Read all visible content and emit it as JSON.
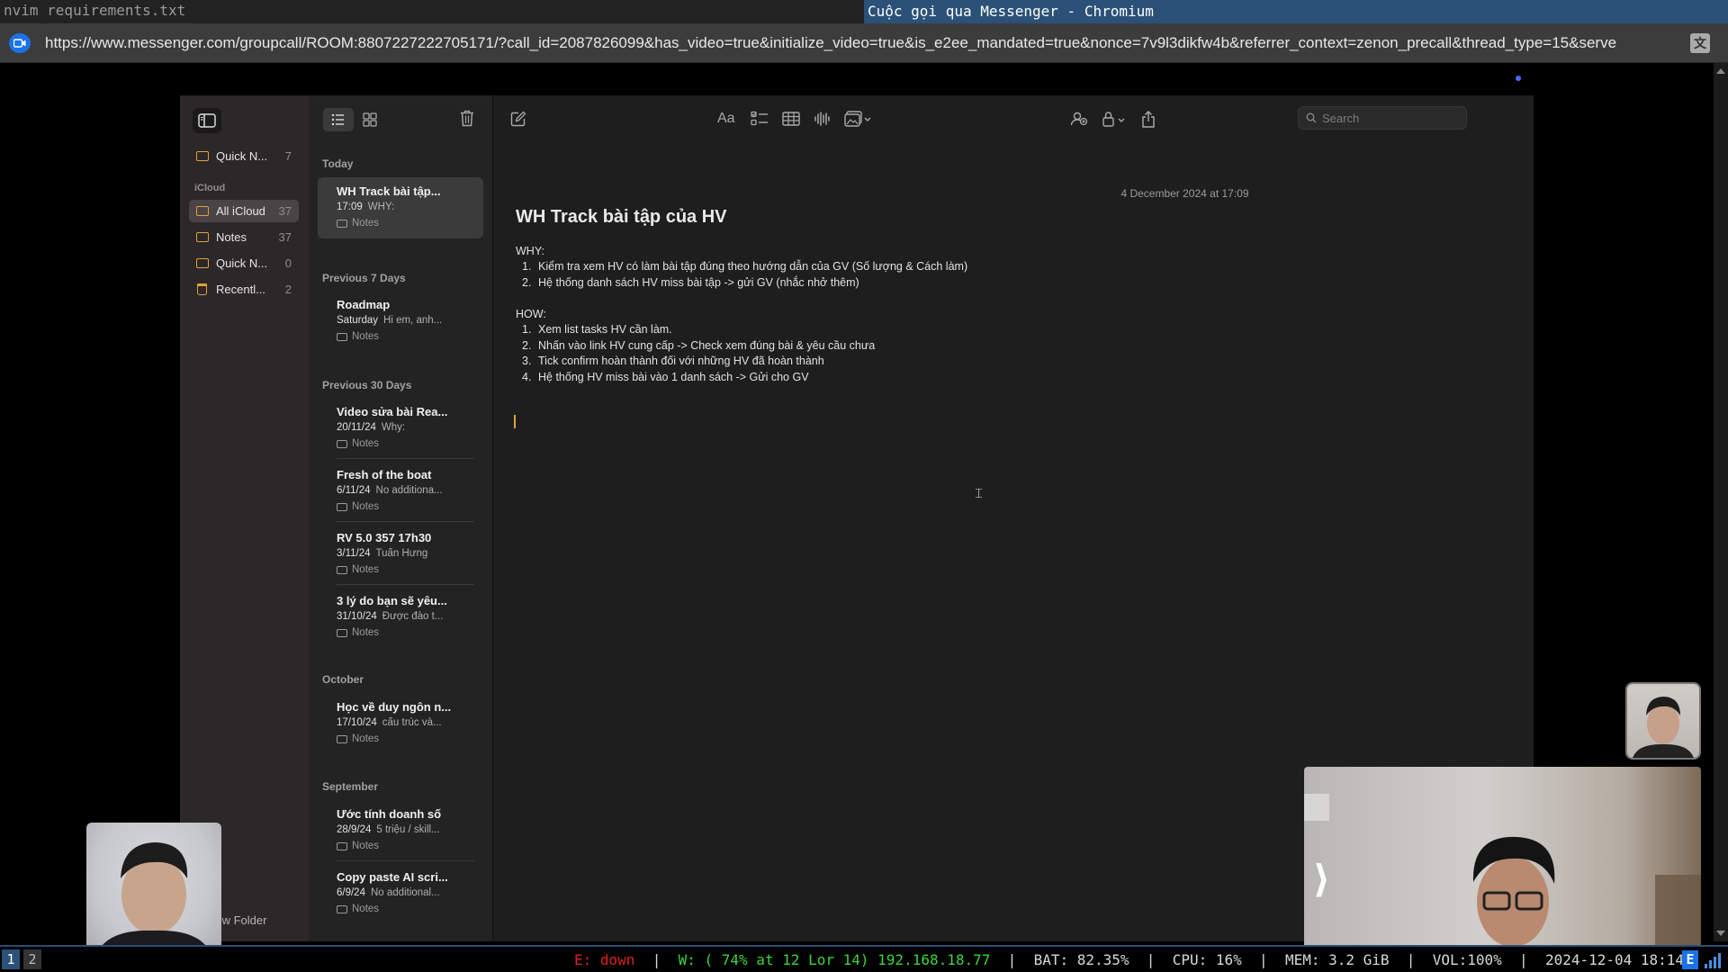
{
  "wm": {
    "left_title": "nvim requirements.txt",
    "right_title": "Cuộc gọi qua Messenger - Chromium"
  },
  "browser": {
    "url": "https://www.messenger.com/groupcall/ROOM:8807227222705171/?call_id=2087826099&has_video=true&initialize_video=true&is_e2ee_mandated=true&nonce=7v9l3dikfw4b&referrer_context=zenon_precall&thread_type=15&serve",
    "translate_icon": "translate-icon",
    "camera_icon": "video-camera-icon"
  },
  "folders": {
    "items": [
      {
        "name": "Quick N...",
        "count": "7"
      },
      {
        "name": "All iCloud",
        "count": "37"
      },
      {
        "name": "Notes",
        "count": "37"
      },
      {
        "name": "Quick N...",
        "count": "0"
      },
      {
        "name": "Recentl...",
        "count": "2"
      }
    ],
    "icloud_label": "iCloud",
    "new_folder": "New Folder"
  },
  "notelist": {
    "groups": [
      "Today",
      "Previous 7 Days",
      "Previous 30 Days",
      "October",
      "September"
    ],
    "notes": [
      {
        "title": "WH Track bài tập...",
        "date": "17:09",
        "preview": "WHY:",
        "folder": "Notes"
      },
      {
        "title": "Roadmap",
        "date": "Saturday",
        "preview": "Hi em, anh...",
        "folder": "Notes"
      },
      {
        "title": "Video sửa bài Rea...",
        "date": "20/11/24",
        "preview": "Why:",
        "folder": "Notes"
      },
      {
        "title": "Fresh of the boat",
        "date": "6/11/24",
        "preview": "No additiona...",
        "folder": "Notes"
      },
      {
        "title": "RV 5.0 357 17h30",
        "date": "3/11/24",
        "preview": "Tuấn Hưng",
        "folder": "Notes"
      },
      {
        "title": "3 lý do bạn sẽ yêu...",
        "date": "31/10/24",
        "preview": "Được đào t...",
        "folder": "Notes"
      },
      {
        "title": "Học về duy ngôn n...",
        "date": "17/10/24",
        "preview": "cấu trúc và...",
        "folder": "Notes"
      },
      {
        "title": "Ước tính doanh số",
        "date": "28/9/24",
        "preview": "5 triệu / skill...",
        "folder": "Notes"
      },
      {
        "title": "Copy paste AI scri...",
        "date": "6/9/24",
        "preview": "No additional...",
        "folder": "Notes"
      }
    ]
  },
  "editor": {
    "toolbar_format_label": "Aa",
    "search_placeholder": "Search",
    "date": "4 December 2024 at 17:09",
    "title": "WH Track bài tập của HV",
    "why_label": "WHY:",
    "why_items": [
      "Kiểm tra xem HV có làm bài tập đúng theo hướng dẫn của GV (Số lượng & Cách làm)",
      "Hệ thống danh sách HV miss bài tập -> gửi GV (nhắc nhở thêm)"
    ],
    "how_label": "HOW:",
    "how_items": [
      "Xem list tasks HV cần làm.",
      "Nhấn vào link HV cung cấp -> Check xem đúng bài & yêu cầu chưa",
      "Tick confirm hoàn thành đối với những HV đã hoàn thành",
      "Hệ thống HV miss bài vào 1 danh sách -> Gửi cho GV"
    ]
  },
  "statusbar": {
    "ws1": "1",
    "ws2": "2",
    "eth": "E: down",
    "wifi": "W: ( 74% at 12 Lor 14) 192.168.18.77",
    "bat": "BAT: 82.35%",
    "cpu": "CPU: 16%",
    "mem": "MEM: 3.2 GiB",
    "vol": "VOL:100%",
    "datetime": "2024-12-04 18:14",
    "kb": "E"
  },
  "colors": {
    "accent_orange": "#e0a23a",
    "wm_blue": "#2b5178",
    "status_red": "#e02020",
    "status_green": "#3cd53c"
  }
}
